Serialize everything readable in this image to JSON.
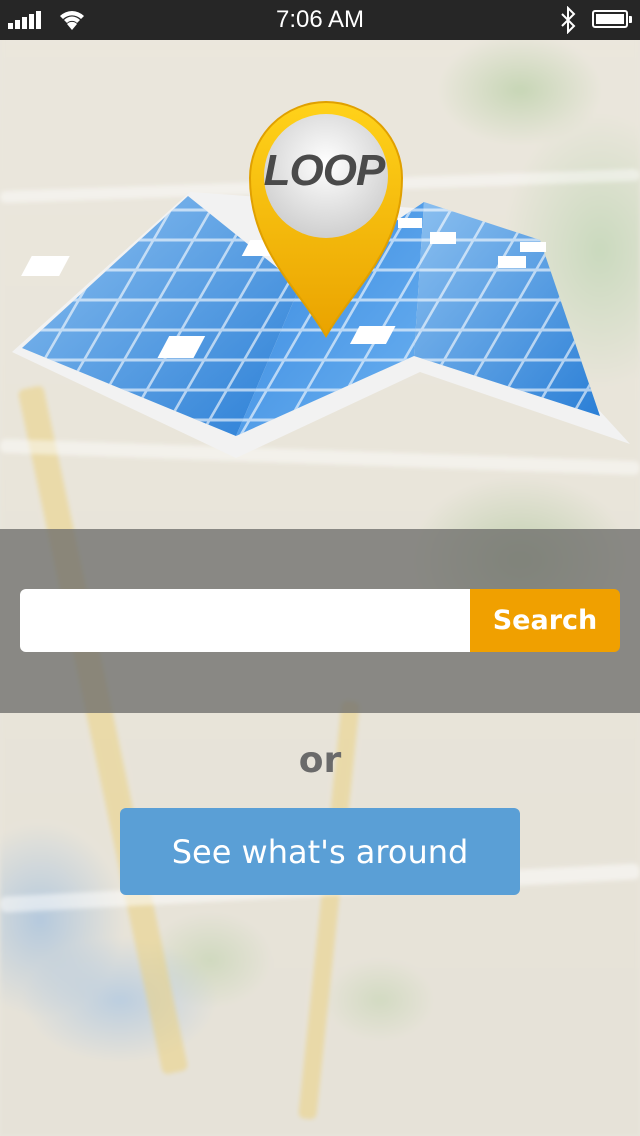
{
  "status_bar": {
    "time": "7:06 AM",
    "icons": [
      "signal-icon",
      "wifi-icon",
      "bluetooth-icon",
      "battery-icon"
    ]
  },
  "logo": {
    "text": "LOOP",
    "pin_color": "#f4b400",
    "map_color": "#3d8fdc"
  },
  "search": {
    "input_value": "",
    "button_label": "Search",
    "button_color": "#f0a000"
  },
  "divider_text": "or",
  "around_button": {
    "label": "See what's around",
    "color": "#5a9fd6"
  }
}
